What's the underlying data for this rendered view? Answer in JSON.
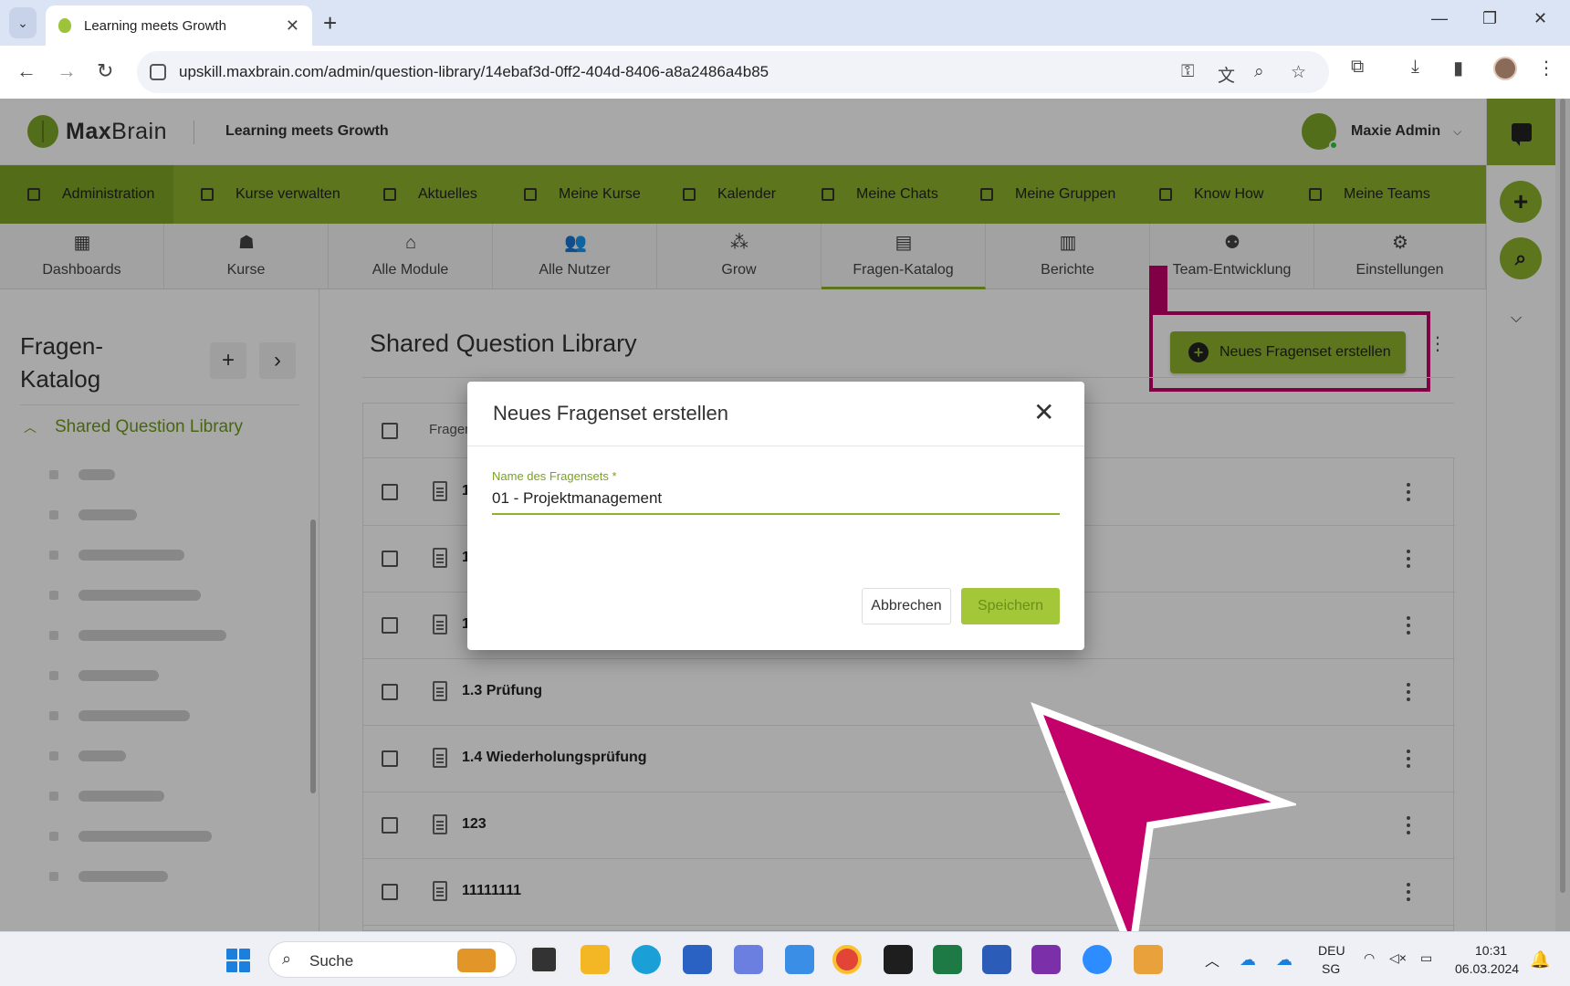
{
  "browser": {
    "tab_title": "Learning meets Growth",
    "url": "upskill.maxbrain.com/admin/question-library/14ebaf3d-0ff2-404d-8406-a8a2486a4b85"
  },
  "header": {
    "brand_bold": "Max",
    "brand_light": "Brain",
    "slogan": "Learning meets Growth",
    "user_name": "Maxie Admin"
  },
  "main_nav": {
    "items": [
      {
        "label": "Administration"
      },
      {
        "label": "Kurse verwalten"
      },
      {
        "label": "Aktuelles"
      },
      {
        "label": "Meine Kurse"
      },
      {
        "label": "Kalender"
      },
      {
        "label": "Meine Chats"
      },
      {
        "label": "Meine Gruppen"
      },
      {
        "label": "Know How"
      },
      {
        "label": "Meine Teams"
      }
    ]
  },
  "sub_nav": {
    "items": [
      {
        "label": "Dashboards",
        "icon": "dashboard-icon"
      },
      {
        "label": "Kurse",
        "icon": "courses-icon"
      },
      {
        "label": "Alle Module",
        "icon": "modules-icon"
      },
      {
        "label": "Alle Nutzer",
        "icon": "users-icon"
      },
      {
        "label": "Grow",
        "icon": "grow-icon"
      },
      {
        "label": "Fragen-Katalog",
        "icon": "question-catalog-icon"
      },
      {
        "label": "Berichte",
        "icon": "reports-icon"
      },
      {
        "label": "Team-Entwicklung",
        "icon": "team-development-icon"
      },
      {
        "label": "Einstellungen",
        "icon": "settings-icon"
      }
    ]
  },
  "sidebar": {
    "title": "Fragen-Katalog",
    "section": "Shared Question Library"
  },
  "content": {
    "title": "Shared Question Library",
    "new_set_button": "Neues Fragenset erstellen",
    "column_header": "Fragen",
    "rows": [
      {
        "name": "1"
      },
      {
        "name": "1"
      },
      {
        "name": "1"
      },
      {
        "name": "1.3 Prüfung"
      },
      {
        "name": "1.4 Wiederholungsprüfung"
      },
      {
        "name": "123"
      },
      {
        "name": "11111111"
      }
    ]
  },
  "dialog": {
    "title": "Neues Fragenset erstellen",
    "field_label": "Name des Fragensets *",
    "field_value": "01 - Projektmanagement",
    "cancel_label": "Abbrechen",
    "save_label": "Speichern"
  },
  "taskbar": {
    "search_placeholder": "Suche",
    "lang": "DEU",
    "region": "SG",
    "time": "10:31",
    "date": "06.03.2024"
  },
  "colors": {
    "brand_green": "#8db22b",
    "highlight_magenta": "#c4006a"
  }
}
